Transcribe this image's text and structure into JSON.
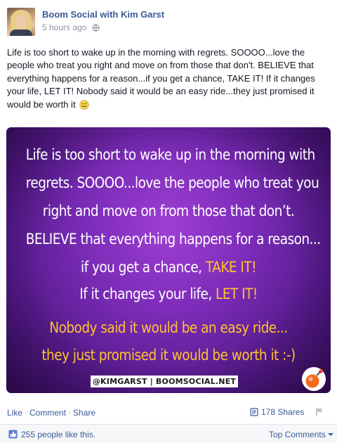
{
  "post": {
    "page_name": "Boom Social with Kim Garst",
    "timestamp": "5 hours ago",
    "text": "Life is too short to wake up in the morning with regrets. SOOOO...love the people who treat you right and move on from those that don't. BELIEVE that everything happens for a reason...if you get a chance, TAKE IT! If it changes your life, LET IT! Nobody said it would be an easy ride...they just promised it would be worth it"
  },
  "image": {
    "lines": [
      "Life is too short to wake up in the morning with",
      "regrets. SOOOO...love the people who treat you",
      "right and move on from those that don’t.",
      "BELIEVE that everything happens for a reason...",
      "if you get a chance, ",
      "If it changes your life, ",
      "Nobody said it would be an easy ride...",
      "they just promised it would be worth it :-)"
    ],
    "highlight_take_it": "TAKE IT!",
    "highlight_let_it": "LET IT!",
    "credit": "@KIMGARST | BOOMSOCIAL.NET",
    "colors": {
      "background": "#7a2bb6",
      "highlight": "#ffc233",
      "text": "#ffffff"
    }
  },
  "actions": {
    "like": "Like",
    "comment": "Comment",
    "share": "Share",
    "separator": "·"
  },
  "shares": "178 Shares",
  "likes": "255 people like this.",
  "top_comments": "Top Comments",
  "icons": [
    "globe-icon",
    "smiley-emoji-icon",
    "shares-icon",
    "flag-icon",
    "thumbs-up-icon",
    "chevron-down-icon"
  ]
}
